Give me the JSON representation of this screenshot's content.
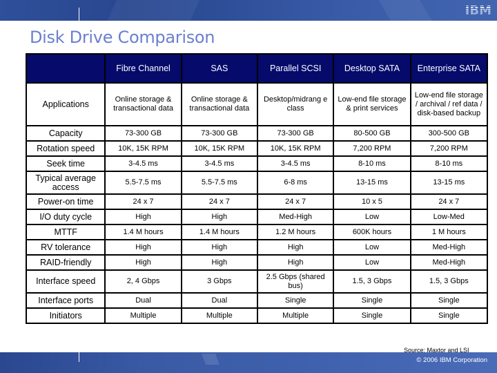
{
  "header": {
    "logo_text": "IBM",
    "title": "Disk Drive Comparison"
  },
  "table": {
    "columns": [
      "",
      "Fibre Channel",
      "SAS",
      "Parallel SCSI",
      "Desktop SATA",
      "Enterprise SATA"
    ],
    "rows": [
      {
        "label": "Applications",
        "cells": [
          "Online storage & transactional data",
          "Online storage & transactional data",
          "Desktop/midrang e class",
          "Low-end file storage & print services",
          "Low-end file storage / archival / ref data / disk-based backup"
        ]
      },
      {
        "label": "Capacity",
        "cells": [
          "73-300 GB",
          "73-300 GB",
          "73-300 GB",
          "80-500 GB",
          "300-500 GB"
        ]
      },
      {
        "label": "Rotation speed",
        "cells": [
          "10K, 15K RPM",
          "10K, 15K RPM",
          "10K, 15K RPM",
          "7,200 RPM",
          "7,200 RPM"
        ]
      },
      {
        "label": "Seek time",
        "cells": [
          "3-4.5 ms",
          "3-4.5 ms",
          "3-4.5 ms",
          "8-10 ms",
          "8-10 ms"
        ]
      },
      {
        "label": "Typical average access",
        "cells": [
          "5.5-7.5 ms",
          "5.5-7.5 ms",
          "6-8 ms",
          "13-15 ms",
          "13-15 ms"
        ]
      },
      {
        "label": "Power-on time",
        "cells": [
          "24 x 7",
          "24 x 7",
          "24 x 7",
          "10 x 5",
          "24 x 7"
        ]
      },
      {
        "label": "I/O duty cycle",
        "cells": [
          "High",
          "High",
          "Med-High",
          "Low",
          "Low-Med"
        ]
      },
      {
        "label": "MTTF",
        "cells": [
          "1.4 M hours",
          "1.4 M hours",
          "1.2 M hours",
          "600K hours",
          "1 M hours"
        ]
      },
      {
        "label": "RV tolerance",
        "cells": [
          "High",
          "High",
          "High",
          "Low",
          "Med-High"
        ]
      },
      {
        "label": "RAID-friendly",
        "cells": [
          "High",
          "High",
          "High",
          "Low",
          "Med-High"
        ]
      },
      {
        "label": "Interface speed",
        "cells": [
          "2, 4 Gbps",
          "3 Gbps",
          "2.5 Gbps (shared bus)",
          "1.5, 3 Gbps",
          "1.5, 3 Gbps"
        ]
      },
      {
        "label": "Interface ports",
        "cells": [
          "Dual",
          "Dual",
          "Single",
          "Single",
          "Single"
        ]
      },
      {
        "label": "Initiators",
        "cells": [
          "Multiple",
          "Multiple",
          "Multiple",
          "Single",
          "Single"
        ]
      }
    ]
  },
  "footer": {
    "source": "Source:  Maxtor and LSI",
    "copyright": "© 2006 IBM Corporation"
  },
  "colors": {
    "header_fill": "#050a6b",
    "title_text": "#6a7fd0",
    "banner": "#3a5aa6"
  }
}
